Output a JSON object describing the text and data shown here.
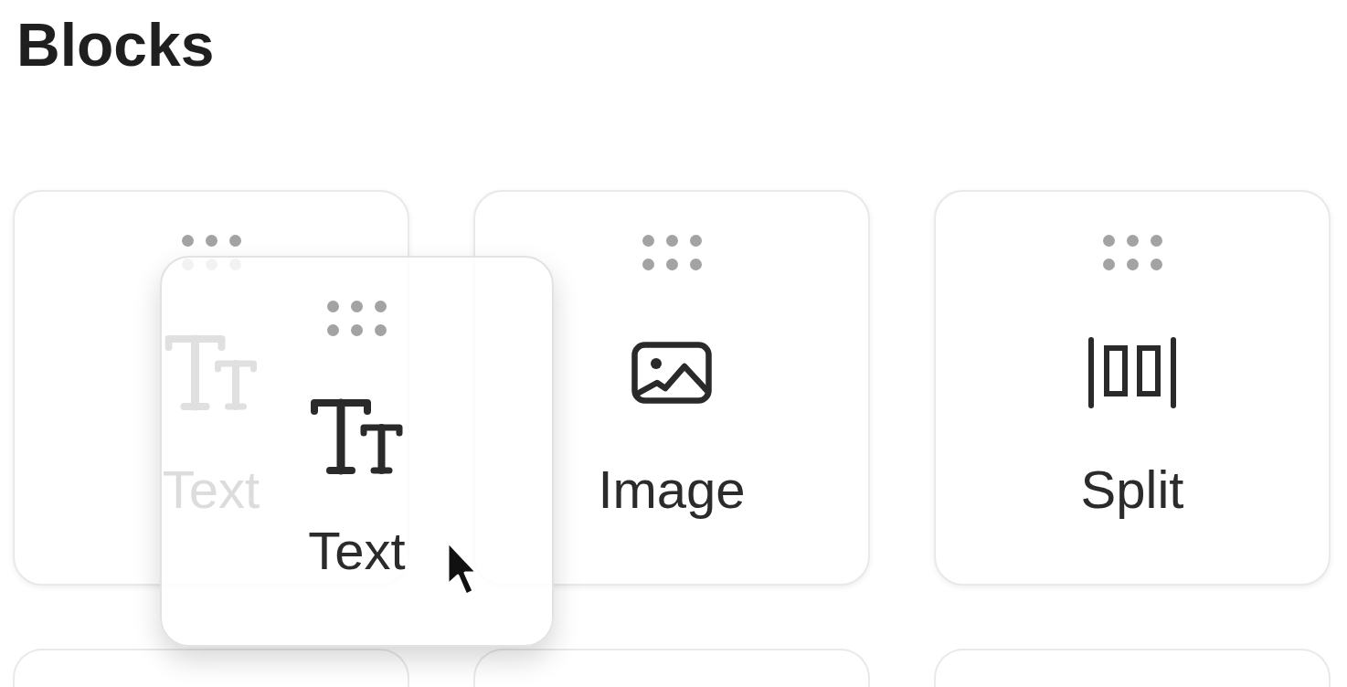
{
  "title": "Blocks",
  "blocks": [
    {
      "label": "Text",
      "kind": "text",
      "dragging": true
    },
    {
      "label": "Image",
      "kind": "image",
      "dragging": false
    },
    {
      "label": "Split",
      "kind": "split",
      "dragging": false
    }
  ],
  "drag_preview": {
    "label": "Text",
    "kind": "text"
  }
}
